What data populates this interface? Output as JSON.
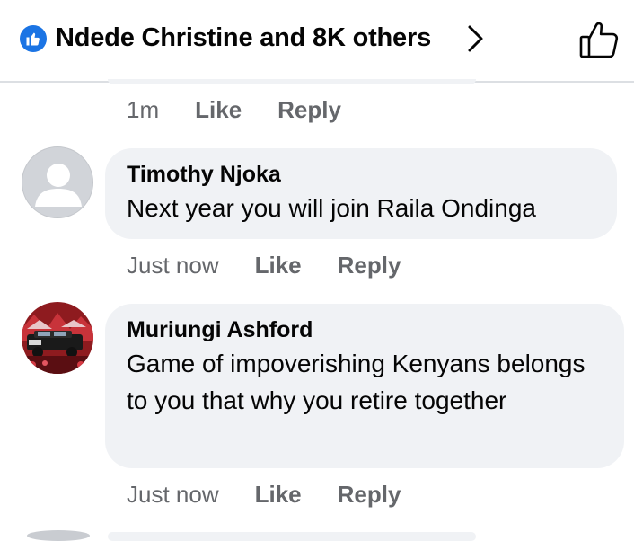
{
  "header": {
    "reactors": "Ndede Christine and 8K others",
    "badge_icon": "like-reaction-icon",
    "chevron_icon": "chevron-right-icon",
    "like_icon": "thumbs-up-outline-icon",
    "accent": "#1b74e4"
  },
  "previous_comment": {
    "time": "1m",
    "like_label": "Like",
    "reply_label": "Reply"
  },
  "comments": [
    {
      "author": "Timothy Njoka",
      "text": "Next year you will join Raila Ondinga",
      "time": "Just now",
      "like_label": "Like",
      "reply_label": "Reply",
      "avatar_icon": "default-profile-avatar"
    },
    {
      "author": "Muriungi Ashford",
      "text": "Game of impoverishing Kenyans belongs to you that why you retire together",
      "time": "Just now",
      "like_label": "Like",
      "reply_label": "Reply",
      "avatar_icon": "car-photo-avatar"
    }
  ],
  "colors": {
    "bubble": "#f0f2f5",
    "meta_text": "#65676b",
    "primary_text": "#050505"
  }
}
